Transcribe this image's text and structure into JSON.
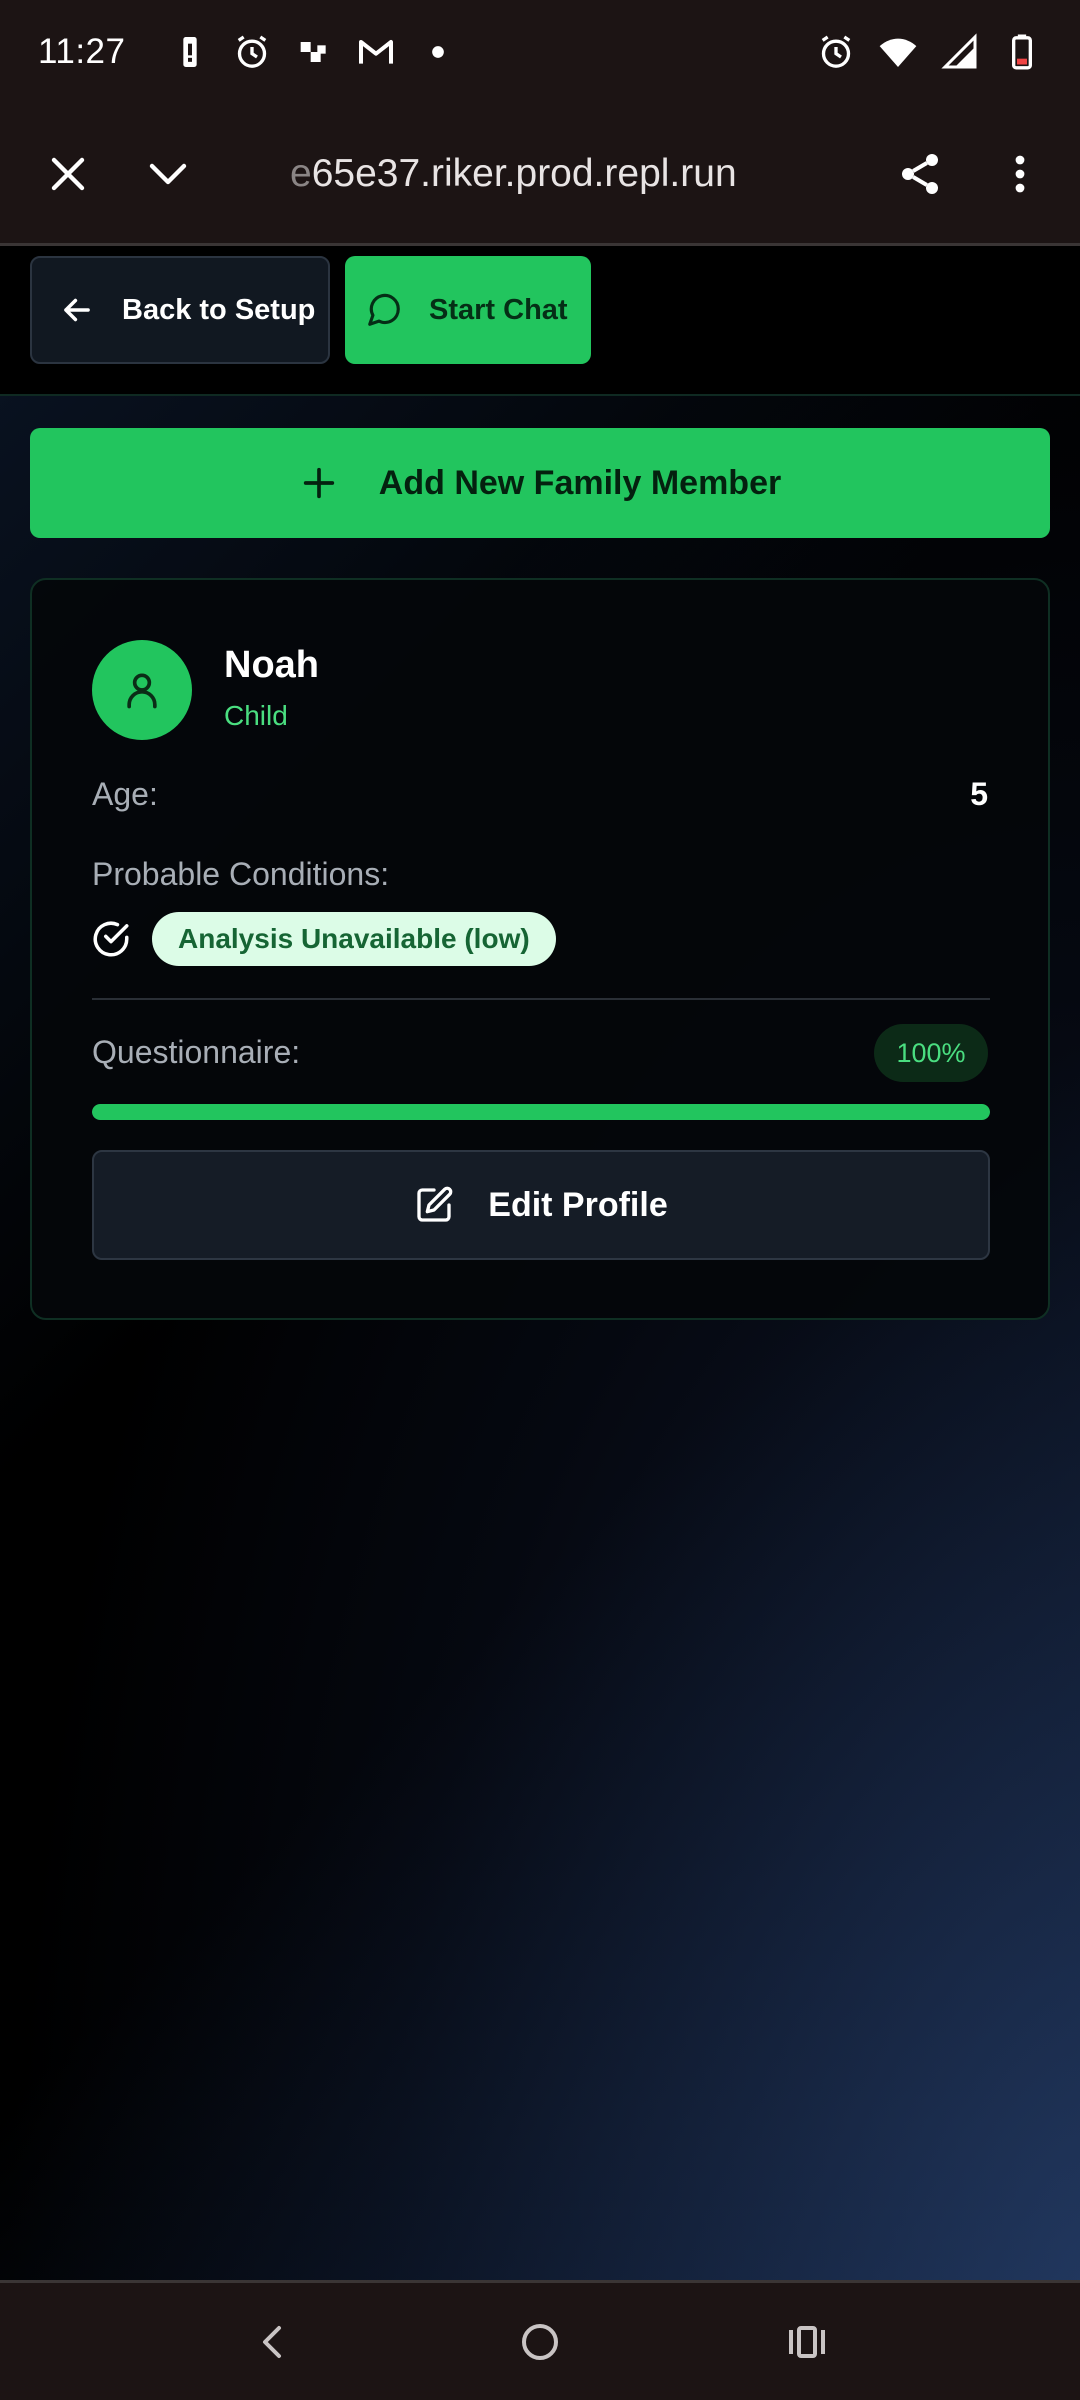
{
  "status_bar": {
    "time": "11:27",
    "icons_left": [
      "battery-alert-icon",
      "alarm-icon",
      "chess-icon",
      "gmail-icon",
      "dot-icon"
    ],
    "icons_right": [
      "alarm-icon",
      "wifi-icon",
      "signal-icon",
      "battery-low-icon"
    ]
  },
  "browser": {
    "url_faded": "e",
    "url": "65e37.riker.prod.repl.run"
  },
  "actions": {
    "back_label": "Back to Setup",
    "chat_label": "Start Chat",
    "add_label": "Add New Family Member"
  },
  "member": {
    "name": "Noah",
    "role": "Child",
    "age_label": "Age:",
    "age_value": "5",
    "conditions_label": "Probable Conditions:",
    "condition_badge": "Analysis Unavailable (low)",
    "questionnaire_label": "Questionnaire:",
    "questionnaire_percent": "100%",
    "questionnaire_progress": 1.0,
    "edit_label": "Edit Profile"
  },
  "colors": {
    "accent": "#22c55e",
    "accent_text": "#4ade80",
    "badge_bg": "#dcfce7",
    "badge_text": "#166534"
  }
}
